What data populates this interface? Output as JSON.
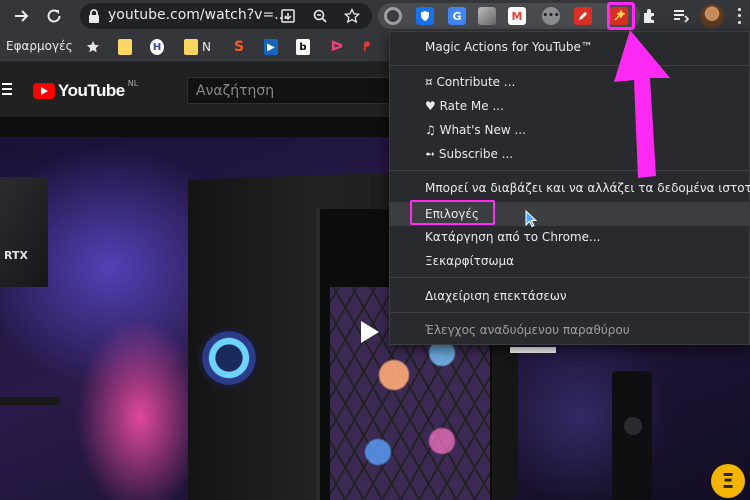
{
  "toolbar": {
    "url": "youtube.com/watch?v=...",
    "extensions": [
      {
        "icon": "gray-circle-icon",
        "color": "#9aa0a6"
      },
      {
        "icon": "shield-icon",
        "color": "#1a73e8"
      },
      {
        "icon": "translate-icon",
        "color": "#4285f4"
      },
      {
        "icon": "square-gray-icon",
        "color": "#8a8a8a"
      },
      {
        "icon": "gmail-icon",
        "color": "#ea4335"
      },
      {
        "icon": "dots-circle-icon",
        "color": "#9aa0a6"
      },
      {
        "icon": "pen-red-icon",
        "color": "#d93025"
      },
      {
        "icon": "magic-actions-icon",
        "color": "#d93025"
      },
      {
        "icon": "puzzle-icon",
        "color": "#e8eaed"
      }
    ]
  },
  "bookmarks": {
    "apps_label": "Εφαρμογές",
    "items": [
      {
        "label": "",
        "icon": "star-icon"
      },
      {
        "label": "",
        "icon": "folder-icon"
      },
      {
        "label": "",
        "icon": "site-icon"
      },
      {
        "label": "N",
        "icon": "folder-icon"
      },
      {
        "label": "",
        "icon": "s-logo-icon"
      },
      {
        "label": "",
        "icon": "play-square-icon"
      },
      {
        "label": "",
        "icon": "b-square-icon"
      },
      {
        "label": "",
        "icon": "pink-d-icon"
      },
      {
        "label": "",
        "icon": "bike-icon"
      }
    ]
  },
  "youtube": {
    "logo_text": "YouTube",
    "region": "NL",
    "search_placeholder": "Αναζήτηση",
    "overlay_text": "RTX",
    "channel_letter": "Ξ"
  },
  "menu": {
    "title": "Magic Actions for YouTube™",
    "links": [
      "¤ Contribute ...",
      "♥ Rate Me ...",
      "♫ What's New ...",
      "➻ Subscribe ..."
    ],
    "permissions": "Μπορεί να διαβάζει και να αλλάζει τα δεδομένα ιστοτόπου",
    "options": "Επιλογές",
    "remove": "Κατάργηση από το Chrome...",
    "unpin": "Ξεκαρφίτσωμα",
    "manage": "Διαχείριση επεκτάσεων",
    "inspect": "Έλεγχος αναδυόμενου παραθύρου"
  },
  "colors": {
    "accent": "#ff29f5",
    "youtube_red": "#ff0000",
    "menu_bg": "#292a2d"
  }
}
